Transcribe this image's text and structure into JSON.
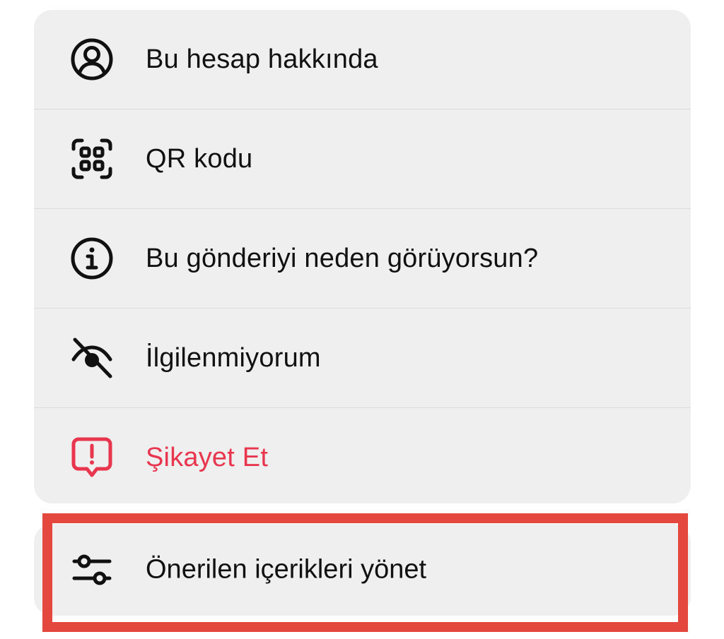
{
  "menu": {
    "items": [
      {
        "label": "Bu hesap hakkında",
        "icon": "account-circle-icon"
      },
      {
        "label": "QR kodu",
        "icon": "qr-code-icon"
      },
      {
        "label": "Bu gönderiyi neden görüyorsun?",
        "icon": "info-icon"
      },
      {
        "label": "İlgilenmiyorum",
        "icon": "eye-off-icon"
      },
      {
        "label": "Şikayet Et",
        "icon": "report-icon"
      }
    ]
  },
  "manage": {
    "label": "Önerilen içerikleri yönet",
    "icon": "sliders-icon"
  },
  "colors": {
    "danger": "#e8364e",
    "highlight": "#e4473e",
    "surface": "#efefef"
  }
}
